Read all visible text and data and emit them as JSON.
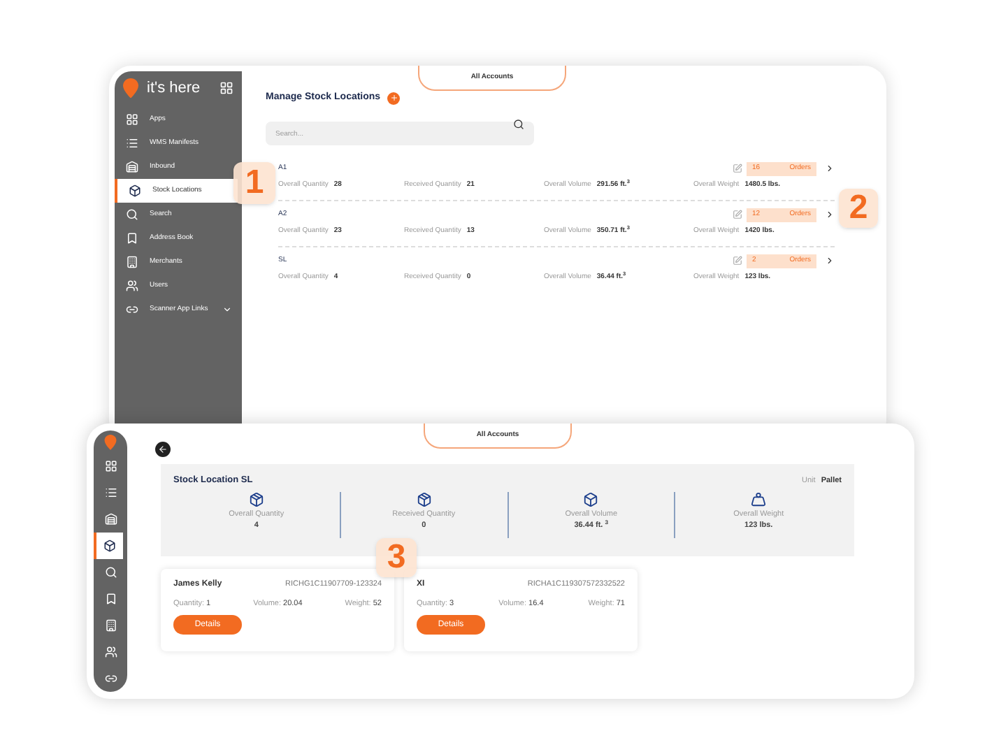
{
  "main_window": {
    "brand": "it's here",
    "sidebar": [
      {
        "label": "Apps",
        "selected": false
      },
      {
        "label": "WMS Manifests",
        "selected": false
      },
      {
        "label": "Inbound",
        "selected": false
      },
      {
        "label": "Stock Locations",
        "selected": true
      },
      {
        "label": "Search",
        "selected": false
      },
      {
        "label": "Address Book",
        "selected": false
      },
      {
        "label": "Merchants",
        "selected": false
      },
      {
        "label": "Users",
        "selected": false
      },
      {
        "label": "Scanner App Links",
        "selected": false,
        "expandable": true
      }
    ],
    "account_tab": "All Accounts",
    "title": "Manage Stock Locations",
    "search": {
      "placeholder": "Search..."
    },
    "locations": [
      {
        "name": "A1",
        "stats": [
          {
            "label": "Overall Quantity",
            "value": "28"
          },
          {
            "label": "Received Quantity",
            "value": "21"
          },
          {
            "label": "Overall Volume",
            "value": "291.56 ft.$^{3}$"
          },
          {
            "label": "Overall Weight",
            "value": "1480.5 lbs."
          }
        ],
        "orders_count": "16",
        "orders_label": "Orders"
      },
      {
        "name": "A2",
        "stats": [
          {
            "label": "Overall Quantity",
            "value": "23"
          },
          {
            "label": "Received Quantity",
            "value": "13"
          },
          {
            "label": "Overall Volume",
            "value": "350.71 ft.$^{3}$"
          },
          {
            "label": "Overall Weight",
            "value": "1420 lbs."
          }
        ],
        "orders_count": "12",
        "orders_label": "Orders"
      },
      {
        "name": "SL",
        "stats": [
          {
            "label": "Overall Quantity",
            "value": "4"
          },
          {
            "label": "Received Quantity",
            "value": "0"
          },
          {
            "label": "Overall Volume",
            "value": "36.44 ft.$^{3}$"
          },
          {
            "label": "Overall Weight",
            "value": "123 lbs."
          }
        ],
        "orders_count": "2",
        "orders_label": "Orders"
      }
    ]
  },
  "detail_window": {
    "nav": [
      {
        "selected": false
      },
      {
        "selected": false
      },
      {
        "selected": false
      },
      {
        "selected": true
      },
      {
        "selected": false
      },
      {
        "selected": false
      },
      {
        "selected": false
      },
      {
        "selected": false
      },
      {
        "selected": false
      }
    ],
    "account_tab": "All Accounts",
    "title": "Stock Location SL",
    "unit_label": "Unit",
    "unit_value": "Pallet",
    "summary": [
      {
        "label": "Overall Quantity",
        "value": "4"
      },
      {
        "label": "Received Quantity",
        "value": "0"
      },
      {
        "label": "Overall Volume",
        "value": "36.44 ft. $^{3}$"
      },
      {
        "label": "Overall Weight",
        "value": "123 lbs."
      }
    ],
    "orders": [
      {
        "name": "James Kelly",
        "code": "RICHG1C11907709-123324",
        "fields": [
          {
            "label": "Quantity:",
            "value": "1"
          },
          {
            "label": "Volume:",
            "value": "20.04"
          },
          {
            "label": "Weight:",
            "value": "52"
          }
        ],
        "button": "Details"
      },
      {
        "name": "XI",
        "code": "RICHA1C119307572332522",
        "fields": [
          {
            "label": "Quantity:",
            "value": "3"
          },
          {
            "label": "Volume:",
            "value": "16.4"
          },
          {
            "label": "Weight:",
            "value": "71"
          }
        ],
        "button": "Details"
      }
    ]
  },
  "callouts": [
    "1",
    "2",
    "3"
  ]
}
